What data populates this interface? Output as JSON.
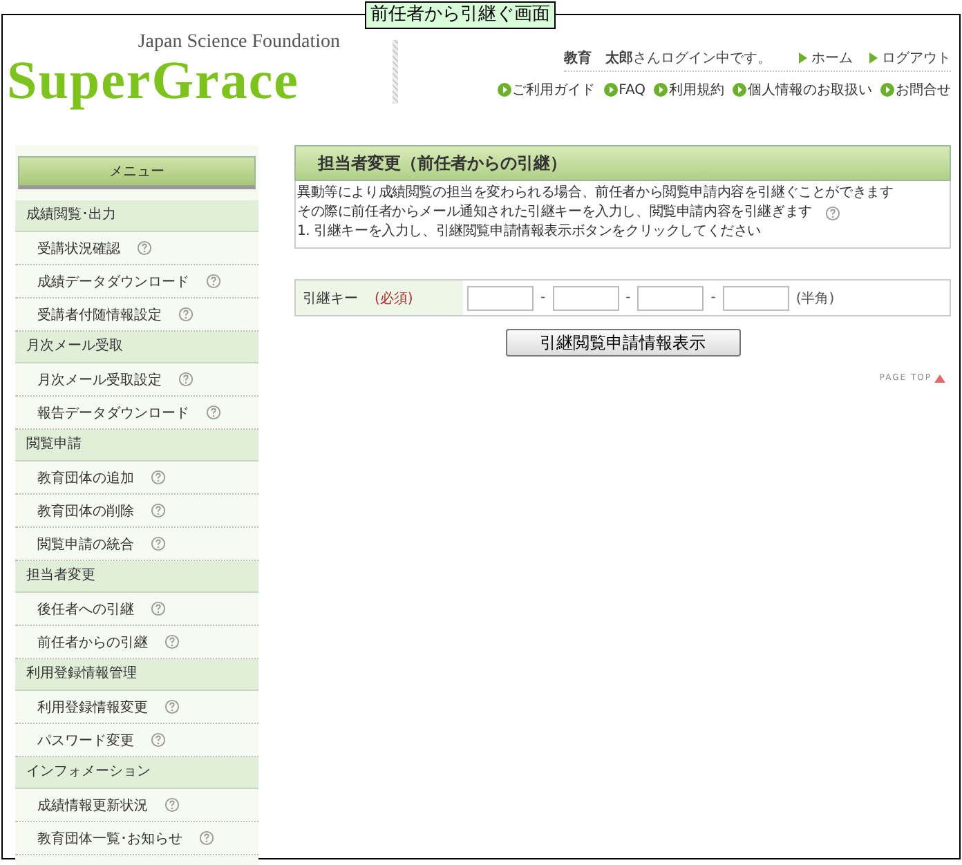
{
  "frame_title": "前任者から引継ぐ画面",
  "header": {
    "org": "Japan Science Foundation",
    "logo": "SuperGrace",
    "user_name": "教育　太郎",
    "user_suffix": "さんログイン中です。",
    "top_links": [
      "ホーム",
      "ログアウト"
    ],
    "nav_links": [
      "ご利用ガイド",
      "FAQ",
      "利用規約",
      "個人情報のお取扱い",
      "お問合せ"
    ]
  },
  "sidebar": {
    "title": "メニュー",
    "sections": [
      {
        "heading": "成績閲覧･出力",
        "items": [
          "受講状況確認",
          "成績データダウンロード",
          "受講者付随情報設定"
        ]
      },
      {
        "heading": "月次メール受取",
        "items": [
          "月次メール受取設定",
          "報告データダウンロード"
        ]
      },
      {
        "heading": "閲覧申請",
        "items": [
          "教育団体の追加",
          "教育団体の削除",
          "閲覧申請の統合"
        ]
      },
      {
        "heading": "担当者変更",
        "items": [
          "後任者への引継",
          "前任者からの引継"
        ]
      },
      {
        "heading": "利用登録情報管理",
        "items": [
          "利用登録情報変更",
          "パスワード変更"
        ]
      },
      {
        "heading": "インフォメーション",
        "items": [
          "成績情報更新状況",
          "教育団体一覧･お知らせ"
        ]
      }
    ]
  },
  "main": {
    "title": "担当者変更（前任者からの引継）",
    "notes": [
      {
        "text": "異動等により成績閲覧の担当を変わられる場合、前任者から閲覧申請内容を引継ぐことができます",
        "help": false
      },
      {
        "text": "その際に前任者からメール通知された引継キーを入力し、閲覧申請内容を引継ぎます",
        "help": true
      },
      {
        "text": "1. 引継キーを入力し、引継閲覧申請情報表示ボタンをクリックしてください",
        "help": false
      }
    ],
    "form": {
      "label": "引継キー",
      "required": "(必須)",
      "separators": [
        "-",
        "-",
        "-"
      ],
      "hint": "(半角)"
    },
    "submit": "引継閲覧申請情報表示",
    "page_top": "PAGE TOP"
  }
}
